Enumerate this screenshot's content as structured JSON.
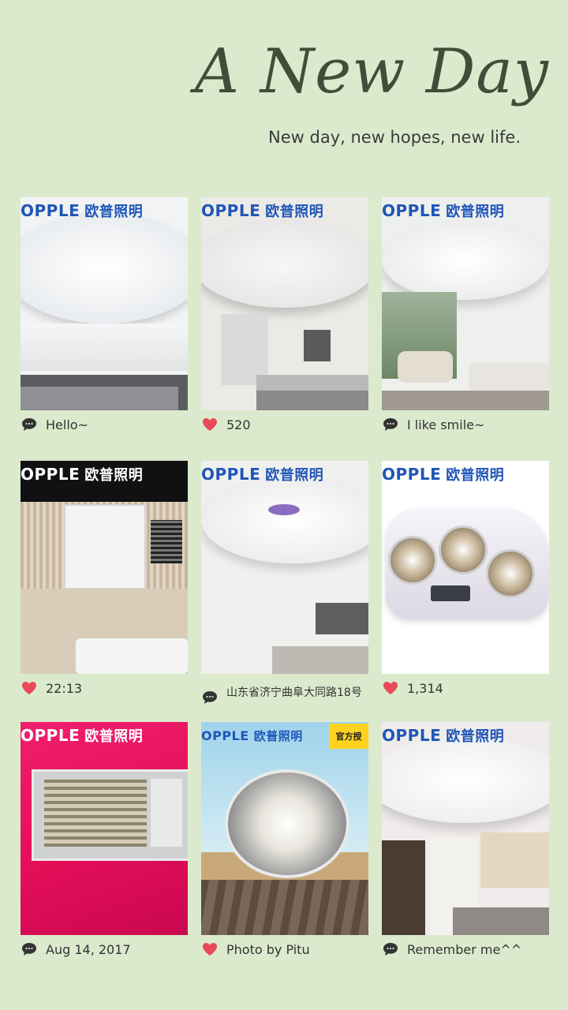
{
  "header": {
    "title": "A New Day",
    "subtitle": "New day, new hopes, new life."
  },
  "brand": {
    "latin": "OPPLE",
    "chinese": "欧普照明",
    "badge": "官方授"
  },
  "colors": {
    "background": "#dbeacd",
    "brand_blue": "#1f56b8",
    "heart_red": "#e84a5a",
    "bubble_dark": "#333333"
  },
  "tiles": [
    {
      "caption": "Hello~",
      "icon": "chat-bubble-icon"
    },
    {
      "caption": "520",
      "icon": "heart-icon"
    },
    {
      "caption": "I like smile~",
      "icon": "chat-bubble-icon"
    },
    {
      "caption": "22:13",
      "icon": "heart-icon"
    },
    {
      "caption": "山东省济宁曲阜大同路18号",
      "icon": "chat-bubble-icon"
    },
    {
      "caption": "1,314",
      "icon": "heart-icon"
    },
    {
      "caption": "Aug 14, 2017",
      "icon": "chat-bubble-icon"
    },
    {
      "caption": "Photo by Pitu",
      "icon": "heart-icon"
    },
    {
      "caption": "Remember me^^",
      "icon": "chat-bubble-icon"
    }
  ]
}
